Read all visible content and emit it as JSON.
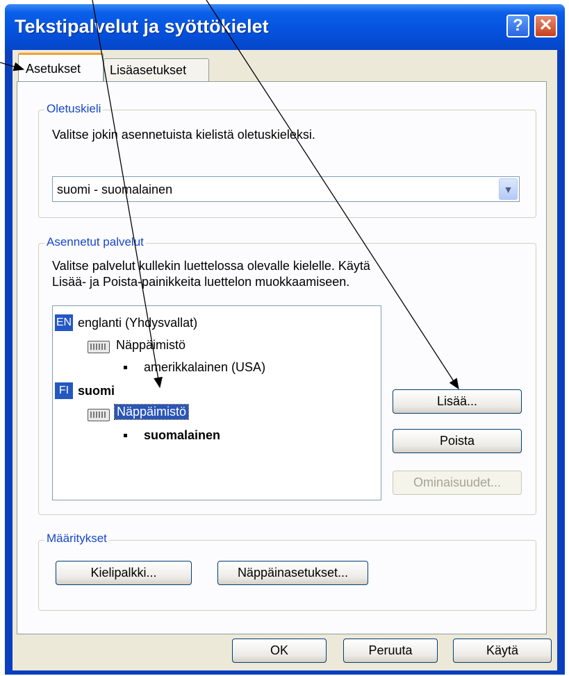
{
  "window": {
    "title": "Tekstipalvelut ja syöttökielet"
  },
  "titlebar_buttons": {
    "help": "?",
    "close": "✕"
  },
  "tabs": [
    {
      "label": "Asetukset",
      "active": true
    },
    {
      "label": "Lisäasetukset",
      "active": false
    }
  ],
  "default_language": {
    "group_title": "Oletuskieli",
    "description": "Valitse jokin asennetuista kielistä oletuskieleksi.",
    "selected": "suomi - suomalainen"
  },
  "installed_services": {
    "group_title": "Asennetut palvelut",
    "description_line1": "Valitse palvelut kullekin luettelossa olevalle kielelle. Käytä",
    "description_line2": "Lisää- ja Poista-painikkeita luettelon muokkaamiseen.",
    "tree": [
      {
        "code": "EN",
        "language": "englanti (Yhdysvallat)",
        "category": "Näppäimistö",
        "layout": "amerikkalainen (USA)"
      },
      {
        "code": "FI",
        "language": "suomi",
        "category": "Näppäimistö",
        "layout": "suomalainen"
      }
    ],
    "buttons": {
      "add": "Lisää...",
      "remove": "Poista",
      "properties": "Ominaisuudet..."
    }
  },
  "preferences": {
    "group_title": "Määritykset",
    "language_bar": "Kielipalkki...",
    "key_settings": "Näppäinasetukset..."
  },
  "footer": {
    "ok": "OK",
    "cancel": "Peruuta",
    "apply": "Käytä"
  },
  "colors": {
    "titlebar": "#0553e0",
    "selection": "#2a55b8",
    "group_title": "#1646c8",
    "arrow": "#000000"
  }
}
